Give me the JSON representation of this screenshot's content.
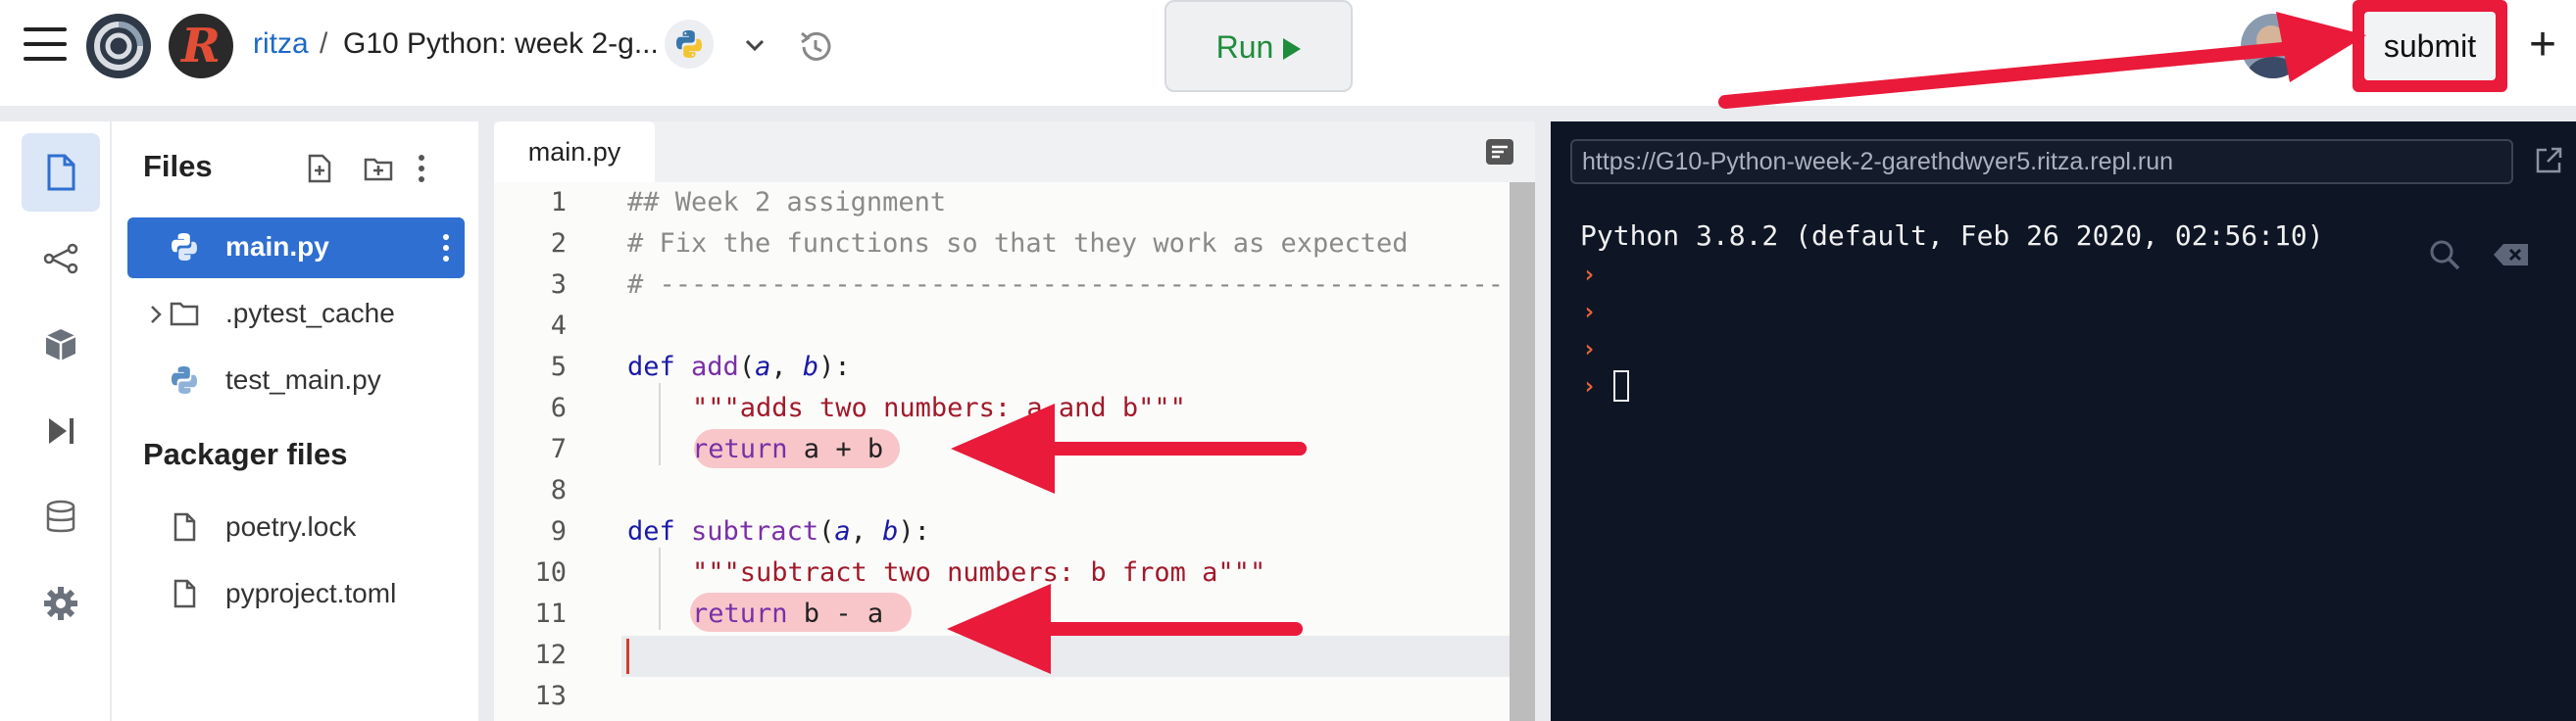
{
  "topbar": {
    "user": "ritza",
    "separator": "/",
    "repl_name": "G10 Python: week 2-g...",
    "run_label": "Run",
    "submit_label": "submit",
    "plus_label": "+",
    "user_initial": "R"
  },
  "files_panel": {
    "title": "Files",
    "items": [
      {
        "name": "main.py",
        "icon": "python-icon",
        "active": true
      },
      {
        "name": ".pytest_cache",
        "icon": "folder-icon",
        "active": false
      },
      {
        "name": "test_main.py",
        "icon": "python-icon",
        "active": false
      }
    ],
    "packager_title": "Packager files",
    "packager_items": [
      {
        "name": "poetry.lock",
        "icon": "file-icon"
      },
      {
        "name": "pyproject.toml",
        "icon": "file-icon"
      }
    ]
  },
  "editor": {
    "tab": "main.py",
    "line_numbers": [
      "1",
      "2",
      "3",
      "4",
      "5",
      "6",
      "7",
      "8",
      "9",
      "10",
      "11",
      "12",
      "13"
    ],
    "lines": {
      "l1": "## Week 2 assignment",
      "l2": "# Fix the functions so that they work as expected",
      "l3": "# -----------------------------------------------------",
      "l5_kw": "def ",
      "l5_fn": "add",
      "l5_open": "(",
      "l5_a": "a",
      "l5_comma": ", ",
      "l5_b": "b",
      "l5_close": "):",
      "l6": "\"\"\"adds two numbers: a and b\"\"\"",
      "l7_kw": "return",
      "l7_rest": " a + b",
      "l9_kw": "def ",
      "l9_fn": "subtract",
      "l9_open": "(",
      "l9_a": "a",
      "l9_comma": ", ",
      "l9_b": "b",
      "l9_close": "):",
      "l10": "\"\"\"subtract two numbers: b from a\"\"\"",
      "l11_kw": "return",
      "l11_rest": " b - a"
    }
  },
  "console": {
    "url": "https://G10-Python-week-2-garethdwyer5.ritza.repl.run",
    "version_line": "Python 3.8.2 (default, Feb 26 2020, 02:56:10)",
    "prompt_symbol": "›"
  },
  "colors": {
    "accent_blue": "#2f6fd1",
    "run_green": "#1f8c3c",
    "annotation_red": "#ea1a3a",
    "console_bg": "#0e1525",
    "prompt_orange": "#e8633a"
  }
}
